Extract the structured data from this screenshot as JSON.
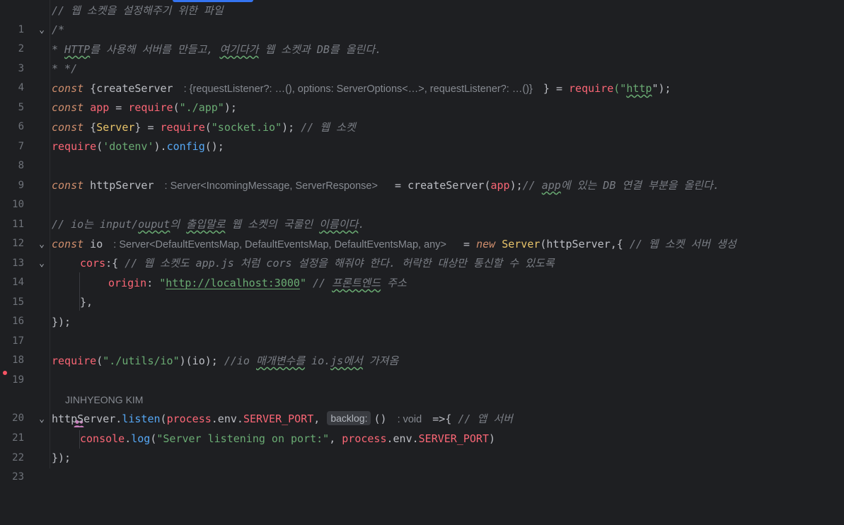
{
  "editor": {
    "author": "JINHYEONG KIM",
    "lines": {
      "l1": {
        "n": "1",
        "t": "// 웹 소켓을 설정해주기 위한 파일"
      },
      "l2": {
        "n": "2",
        "t": "/*"
      },
      "l3": {
        "n": "3",
        "a": "* ",
        "b": "HTTP",
        "c": "를 사용해 서버를 만들고, ",
        "d": "여기다가",
        "e": " 웹 소켓과 DB를 올린다."
      },
      "l4": {
        "n": "4",
        "t": "* */"
      },
      "l5": {
        "n": "5",
        "kw": "const",
        "a": " {createServer ",
        "hint": ": {requestListener?: …(), options: ServerOptions<…>, requestListener?: …()}",
        "b": " } = ",
        "fn": "require",
        "p1": "(\"",
        "s": "http",
        "p2": "\");"
      },
      "l6": {
        "n": "6",
        "kw": "const",
        "sp": " ",
        "v": "app",
        "eq": " = ",
        "fn": "require",
        "p1": "(",
        "s": "\"./app\"",
        "p2": ");"
      },
      "l7": {
        "n": "7",
        "kw": "const",
        "a": " {",
        "cls": "Server",
        "b": "} = ",
        "fn": "require",
        "p1": "(",
        "s": "\"socket.io\"",
        "p2": "); ",
        "cm": "// 웹 소켓"
      },
      "l8": {
        "n": "8",
        "fn": "require",
        "p1": "(",
        "s": "'dotenv'",
        "p2": ").",
        "m": "config",
        "p3": "();"
      },
      "l9": {
        "n": "9"
      },
      "l10": {
        "n": "10",
        "kw": "const",
        "a": " httpServer ",
        "hint": ": Server<IncomingMessage, ServerResponse>",
        "b": "  = ",
        "f2": "createServer",
        "p1": "(",
        "v": "app",
        "p2": ");",
        "cm1": "// ",
        "cm2": "app",
        "cm3": "에 있는 DB 연결 부분을 올린다."
      },
      "l11": {
        "n": "11"
      },
      "l12": {
        "n": "12",
        "c1": "// io는 input/",
        "c2": "ouput",
        "c3": "의 ",
        "c4": "출입말로",
        "c5": " 웹 소켓의 국룰인 ",
        "c6": "이름이다",
        "c7": "."
      },
      "l13": {
        "n": "13",
        "kw": "const",
        "a": " io ",
        "hint": ": Server<DefaultEventsMap, DefaultEventsMap, DefaultEventsMap, any>",
        "b": "  = ",
        "nw": "new",
        "sp": " ",
        "cls": "Server",
        "p1": "(httpServer,{ ",
        "cm": "// 웹 소켓 서버 생성"
      },
      "l14": {
        "n": "14",
        "prop": "cors",
        "p1": ":{ ",
        "cm": "// 웹 소켓도 app.js 처럼 cors 설정을 해줘야 한다. 허락한 대상만 통신할 수 있도록"
      },
      "l15": {
        "n": "15",
        "prop": "origin",
        "p1": ": ",
        "q1": "\"",
        "s": "http://localhost:3000",
        "q2": "\"",
        "sp": " ",
        "cm1": "// ",
        "cm2": "프론트엔드",
        "cm3": " 주소"
      },
      "l16": {
        "n": "16",
        "t": "},"
      },
      "l17": {
        "n": "17",
        "t": "});"
      },
      "l18": {
        "n": "18"
      },
      "l19": {
        "n": "19",
        "fn": "require",
        "p1": "(",
        "s": "\"./utils/io\"",
        "p2": ")(io); ",
        "c1": "//io ",
        "c2": "매개변수를",
        "c3": " io.",
        "c4": "js에서",
        "c5": " 가져옴"
      },
      "l20": {
        "n": "20"
      },
      "l21": {
        "n": "21",
        "a": "httpServer.",
        "m": "listen",
        "p1": "(",
        "pr": "process",
        "d1": ".env.",
        "pr2": "SERVER_PORT",
        "p2": ",",
        "chip": "backlog:",
        "p3": "() ",
        "hint": ": void",
        "p4": " =>{ ",
        "cm": "// 앱 서버"
      },
      "l22": {
        "n": "22",
        "fn": "console",
        "d": ".",
        "m": "log",
        "p1": "(",
        "s": "\"Server listening on port:\"",
        "p2": ", ",
        "pr": "process",
        "d1": ".env.",
        "pr2": "SERVER_PORT",
        "p3": ")"
      },
      "l23": {
        "n": "23",
        "t": "});"
      }
    }
  }
}
